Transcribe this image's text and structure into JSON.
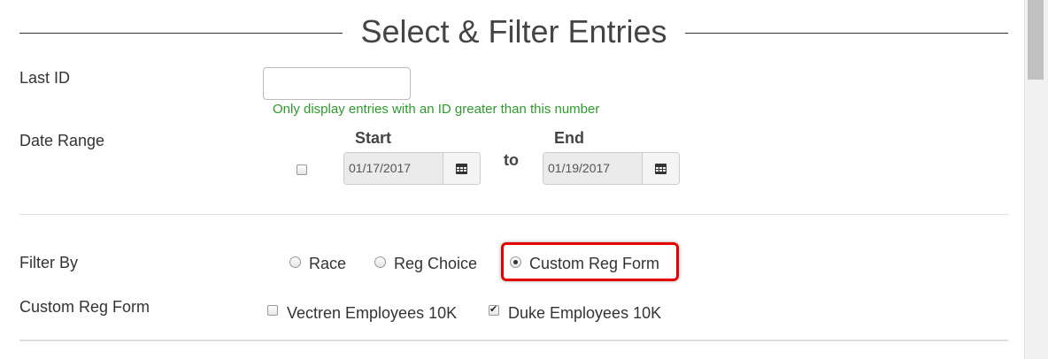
{
  "header": {
    "title": "Select & Filter Entries"
  },
  "last_id": {
    "label": "Last ID",
    "value": "",
    "help": "Only display entries with an ID greater than this number"
  },
  "date_range": {
    "label": "Date Range",
    "enabled": false,
    "start_label": "Start",
    "end_label": "End",
    "to_label": "to",
    "start_value": "01/17/2017",
    "end_value": "01/19/2017"
  },
  "filter_by": {
    "label": "Filter By",
    "options": [
      {
        "label": "Race",
        "selected": false
      },
      {
        "label": "Reg Choice",
        "selected": false
      },
      {
        "label": "Custom Reg Form",
        "selected": true
      }
    ]
  },
  "custom_reg_form": {
    "label": "Custom Reg Form",
    "options": [
      {
        "label": "Vectren Employees 10K",
        "checked": false
      },
      {
        "label": "Duke Employees 10K",
        "checked": true
      }
    ]
  },
  "colors": {
    "help_text": "#2e9a2e",
    "highlight": "#e30000"
  },
  "icons": [
    "calendar-icon"
  ]
}
